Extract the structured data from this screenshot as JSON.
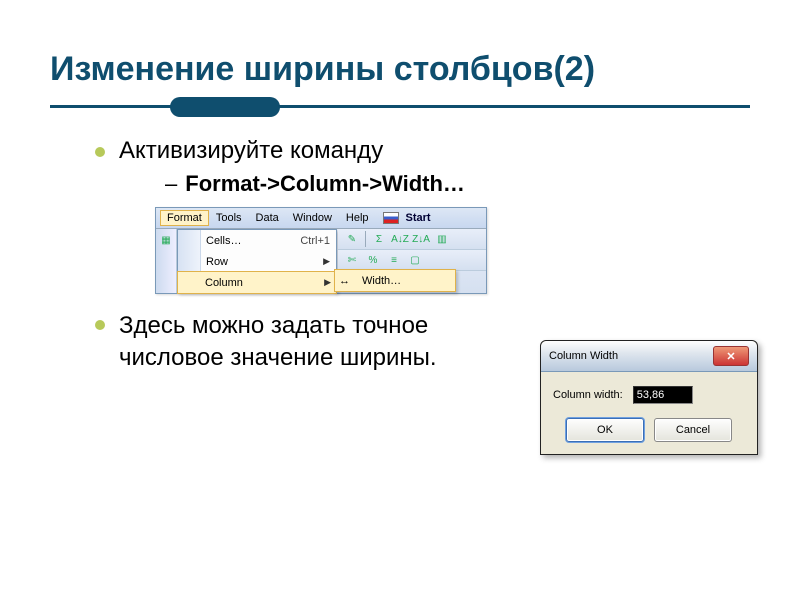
{
  "title": "Изменение ширины столбцов(2)",
  "bullets": {
    "b1": "Активизируйте команду",
    "b2": "Format->Column->Width…",
    "b3": "Здесь можно задать точное числовое значение ширины."
  },
  "menubar": {
    "items": [
      "Format",
      "Tools",
      "Data",
      "Window",
      "Help"
    ],
    "start": "Start"
  },
  "dropdown": {
    "cells": "Cells…",
    "cells_shortcut": "Ctrl+1",
    "row": "Row",
    "column": "Column"
  },
  "submenu": {
    "width": "Width…"
  },
  "toolbar_hints": {
    "sigma": "Σ",
    "sort_az": "A↓Z",
    "sort_za": "Z↓A",
    "percent": "%"
  },
  "dialog": {
    "title": "Column Width",
    "label": "Column width:",
    "value": "53,86",
    "ok": "OK",
    "cancel": "Cancel"
  }
}
